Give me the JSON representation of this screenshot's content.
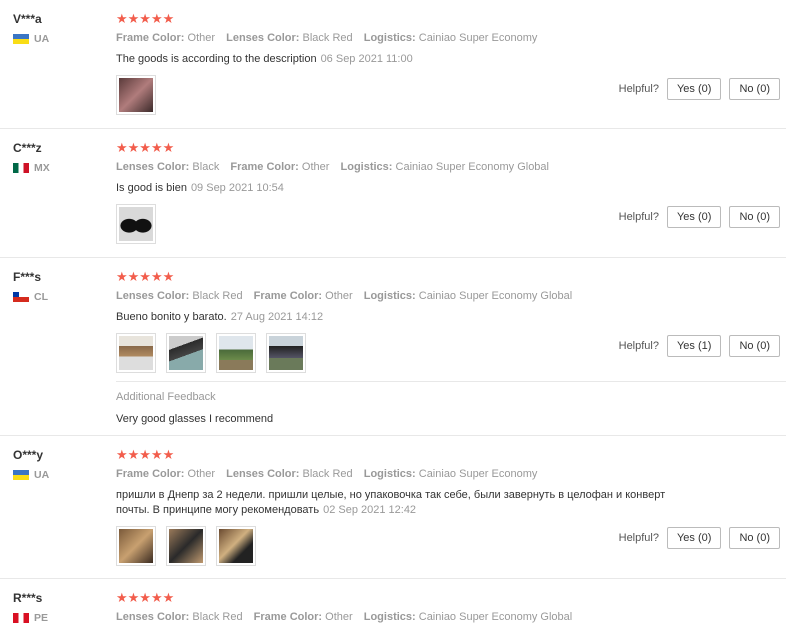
{
  "rating_stars": "★★★★★",
  "helpful_label": "Helpful?",
  "reviews": [
    {
      "user": "V***a",
      "country": "UA",
      "attrs": [
        {
          "k": "Frame Color:",
          "v": "Other"
        },
        {
          "k": "Lenses Color:",
          "v": "Black Red"
        },
        {
          "k": "Logistics:",
          "v": "Cainiao Super Economy"
        }
      ],
      "text": "The goods is according to the description",
      "date": "06 Sep 2021 11:00",
      "yes": "Yes (0)",
      "no": "No (0)"
    },
    {
      "user": "C***z",
      "country": "MX",
      "attrs": [
        {
          "k": "Lenses Color:",
          "v": "Black"
        },
        {
          "k": "Frame Color:",
          "v": "Other"
        },
        {
          "k": "Logistics:",
          "v": "Cainiao Super Economy Global"
        }
      ],
      "text": "Is good is bien",
      "date": "09 Sep 2021 10:54",
      "yes": "Yes (0)",
      "no": "No (0)"
    },
    {
      "user": "F***s",
      "country": "CL",
      "attrs": [
        {
          "k": "Lenses Color:",
          "v": "Black Red"
        },
        {
          "k": "Frame Color:",
          "v": "Other"
        },
        {
          "k": "Logistics:",
          "v": "Cainiao Super Economy Global"
        }
      ],
      "text": "Bueno bonito y barato.",
      "date": "27 Aug 2021 14:12",
      "yes": "Yes (1)",
      "no": "No (0)",
      "additional_title": "Additional Feedback",
      "additional_text": "Very good glasses I recommend"
    },
    {
      "user": "O***y",
      "country": "UA",
      "attrs": [
        {
          "k": "Frame Color:",
          "v": "Other"
        },
        {
          "k": "Lenses Color:",
          "v": "Black Red"
        },
        {
          "k": "Logistics:",
          "v": "Cainiao Super Economy"
        }
      ],
      "text": "пришли в Днепр за 2 недели. пришли целые, но упаковочка так себе, были завернуть в целофан и конверт почты. В принципе могу рекомендовать",
      "date": "02 Sep 2021 12:42",
      "yes": "Yes (0)",
      "no": "No (0)"
    },
    {
      "user": "R***s",
      "country": "PE",
      "attrs": [
        {
          "k": "Lenses Color:",
          "v": "Black Red"
        },
        {
          "k": "Frame Color:",
          "v": "Other"
        },
        {
          "k": "Logistics:",
          "v": "Cainiao Super Economy Global"
        }
      ]
    }
  ]
}
